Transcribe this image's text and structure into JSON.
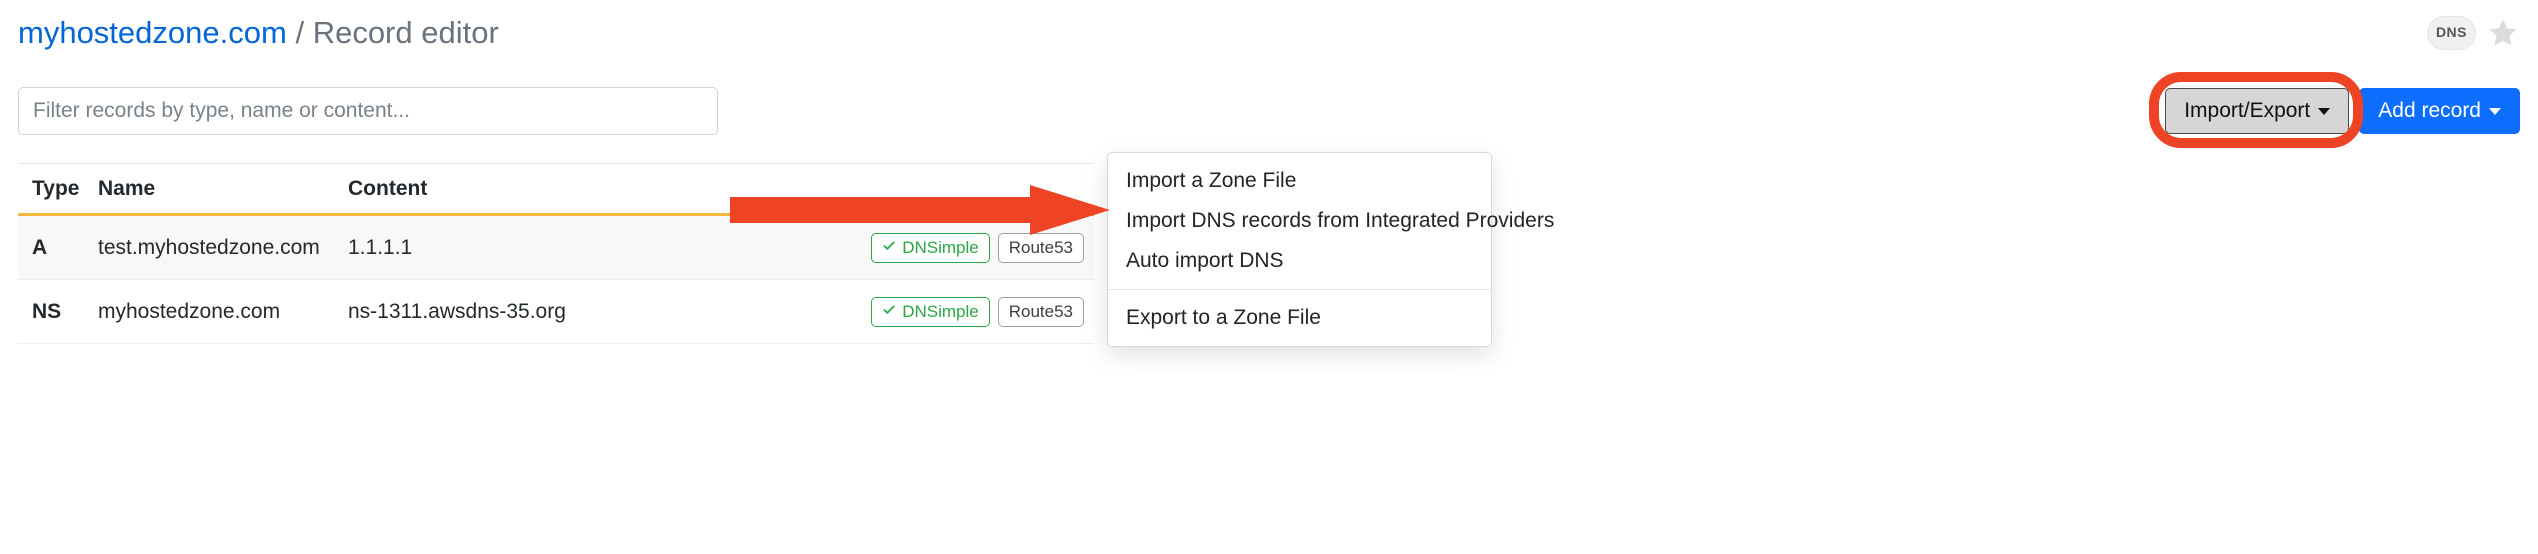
{
  "breadcrumb": {
    "domain": "myhostedzone.com",
    "separator": "/",
    "page": "Record editor"
  },
  "header": {
    "dns_pill": "DNS"
  },
  "toolbar": {
    "filter_placeholder": "Filter records by type, name or content...",
    "import_export_label": "Import/Export",
    "add_record_label": "Add record"
  },
  "table": {
    "headers": {
      "type": "Type",
      "name": "Name",
      "content": "Content"
    },
    "rows": [
      {
        "type": "A",
        "name": "test.myhostedzone.com",
        "content": "1.1.1.1",
        "provider_primary": "DNSimple",
        "provider_secondary": "Route53"
      },
      {
        "type": "NS",
        "name": "myhostedzone.com",
        "content": "ns-1311.awsdns-35.org",
        "provider_primary": "DNSimple",
        "provider_secondary": "Route53"
      }
    ]
  },
  "dropdown": {
    "items_top": [
      "Import a Zone File",
      "Import DNS records from Integrated Providers",
      "Auto import DNS"
    ],
    "items_bottom": [
      "Export to a Zone File"
    ]
  },
  "annotation": {
    "color": "#ee4325"
  }
}
